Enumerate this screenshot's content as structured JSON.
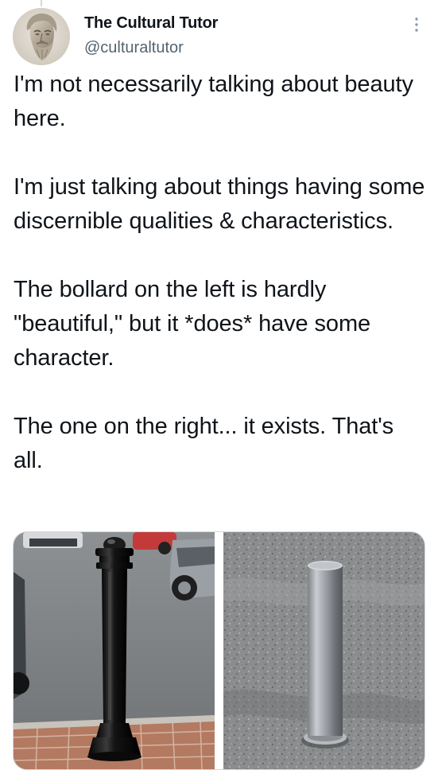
{
  "author": {
    "display_name": "The Cultural Tutor",
    "handle": "@culturaltutor",
    "avatar_icon": "classical-bust-avatar"
  },
  "actions": {
    "more_icon": "more-vertical-icon"
  },
  "tweet": {
    "paragraphs": [
      "I'm not necessarily talking about beauty here.",
      "I'm just talking about things having some discernible qualities & characteristics.",
      "The bollard on the left is hardly \"beautiful,\" but it *does* have some character.",
      "The one on the right... it exists. That's all."
    ]
  },
  "media": {
    "images": [
      {
        "subject": "black ornate cast-iron bollard on brick pavement"
      },
      {
        "subject": "plain stainless steel cylindrical bollard on asphalt"
      }
    ]
  },
  "colors": {
    "text_primary": "#0f1419",
    "text_secondary": "#536471",
    "border": "#cfd9de"
  }
}
